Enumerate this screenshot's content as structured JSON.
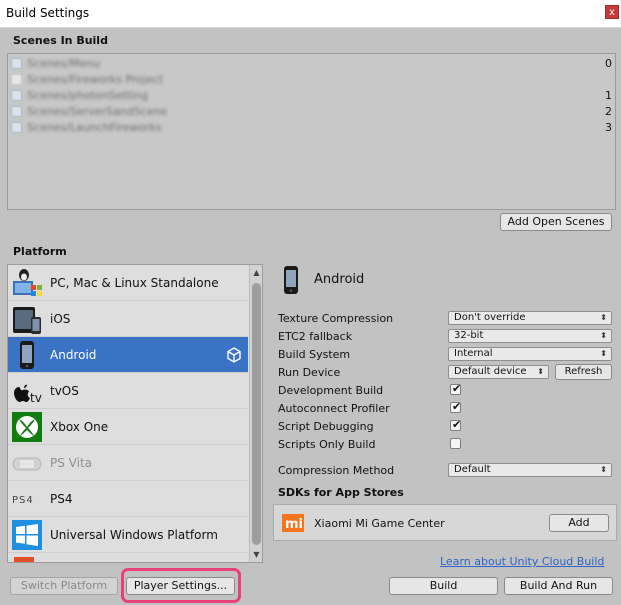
{
  "window": {
    "title": "Build Settings",
    "close_glyph": "x"
  },
  "scenes": {
    "heading": "Scenes In Build",
    "items": [
      {
        "name": "Scenes/Menu",
        "index": "0",
        "checked": true
      },
      {
        "name": "Scenes/Fireworks Project",
        "index": "",
        "checked": false
      },
      {
        "name": "Scenes/photonSetting",
        "index": "1",
        "checked": true
      },
      {
        "name": "Scenes/ServerSandScene",
        "index": "2",
        "checked": true
      },
      {
        "name": "Scenes/LaunchFireworks",
        "index": "3",
        "checked": true
      }
    ],
    "add_open_scenes": "Add Open Scenes"
  },
  "platform": {
    "heading": "Platform",
    "items": [
      {
        "label": "PC, Mac & Linux Standalone",
        "icon": "pc-mac-linux-icon",
        "selected": false
      },
      {
        "label": "iOS",
        "icon": "ios-device-icon",
        "selected": false
      },
      {
        "label": "Android",
        "icon": "android-phone-icon",
        "selected": true
      },
      {
        "label": "tvOS",
        "icon": "apple-tv-icon",
        "selected": false
      },
      {
        "label": "Xbox One",
        "icon": "xbox-icon",
        "selected": false
      },
      {
        "label": "PS Vita",
        "icon": "ps-vita-icon",
        "selected": false,
        "dim": true
      },
      {
        "label": "PS4",
        "icon": "ps4-icon",
        "selected": false
      },
      {
        "label": "Universal Windows Platform",
        "icon": "windows-icon",
        "selected": false
      }
    ]
  },
  "settings": {
    "platform_name": "Android",
    "texture_compression": {
      "label": "Texture Compression",
      "value": "Don't override"
    },
    "etc2_fallback": {
      "label": "ETC2 fallback",
      "value": "32-bit"
    },
    "build_system": {
      "label": "Build System",
      "value": "Internal"
    },
    "run_device": {
      "label": "Run Device",
      "value": "Default device",
      "refresh": "Refresh"
    },
    "development_build": {
      "label": "Development Build",
      "checked": true
    },
    "autoconnect_profiler": {
      "label": "Autoconnect Profiler",
      "checked": true
    },
    "script_debugging": {
      "label": "Script Debugging",
      "checked": true
    },
    "scripts_only_build": {
      "label": "Scripts Only Build",
      "checked": false
    },
    "compression_method": {
      "label": "Compression Method",
      "value": "Default"
    }
  },
  "sdks": {
    "heading": "SDKs for App Stores",
    "item": "Xiaomi Mi Game Center",
    "add": "Add",
    "logo_text": "mi"
  },
  "footer": {
    "cloud_link": "Learn about Unity Cloud Build",
    "switch_platform": "Switch Platform",
    "player_settings": "Player Settings...",
    "build": "Build",
    "build_and_run": "Build And Run"
  },
  "colors": {
    "selection": "#3a72c4",
    "highlight": "#e8407a",
    "link": "#2f63c4"
  }
}
